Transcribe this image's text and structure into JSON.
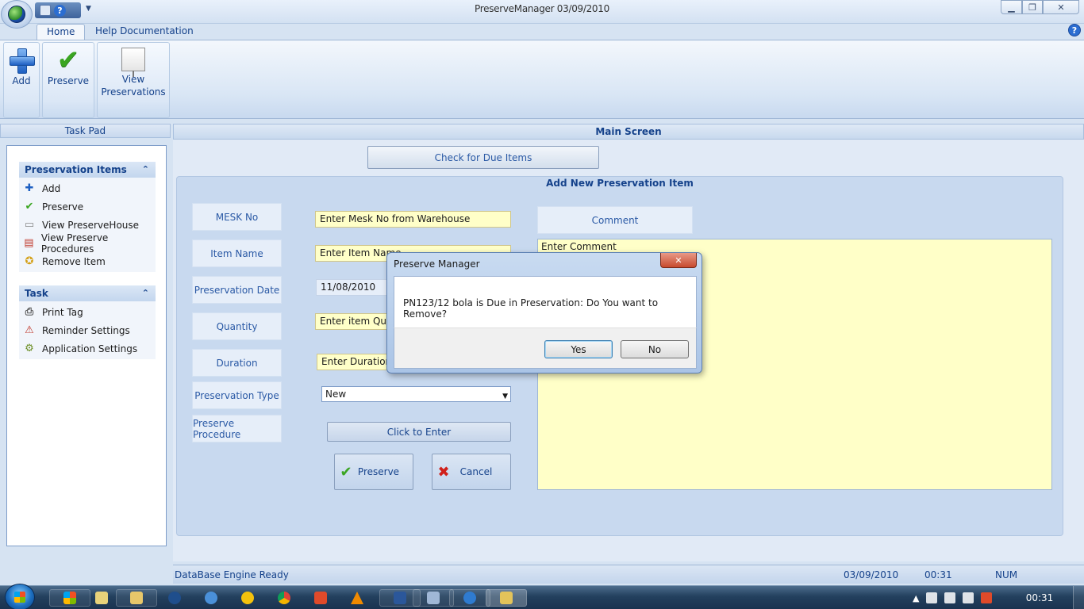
{
  "window": {
    "title": "PreserveManager 03/09/2010"
  },
  "ribbon": {
    "tabs": [
      "Home",
      "Help Documentation"
    ],
    "buttons": [
      {
        "label": "Add",
        "icon": "add-icon"
      },
      {
        "label": "Preserve",
        "icon": "check-icon"
      },
      {
        "label": "View\nPreservations",
        "icon": "board-icon"
      }
    ]
  },
  "taskpad": {
    "title": "Task Pad",
    "sections": [
      {
        "title": "Preservation Items",
        "items": [
          "Add",
          "Preserve",
          "View PreserveHouse",
          "View Preserve Procedures",
          "Remove Item"
        ]
      },
      {
        "title": "Task",
        "items": [
          "Print Tag",
          "Reminder Settings",
          "Application Settings"
        ]
      }
    ]
  },
  "main": {
    "title": "Main Screen",
    "due_button": "Check for Due Items",
    "panel_title": "Add New Preservation Item",
    "labels": {
      "mesk": "MESK No",
      "item_name": "Item Name",
      "date": "Preservation Date",
      "quantity": "Quantity",
      "duration": "Duration",
      "type": "Preservation Type",
      "procedure": "Preserve Procedure",
      "comment": "Comment"
    },
    "inputs": {
      "mesk": "Enter Mesk No from Warehouse",
      "item_name": "Enter Item Name",
      "date": "11/08/2010",
      "quantity": "Enter item Quant",
      "duration": "Enter Duration o",
      "type": "New",
      "comment": "Enter Comment"
    },
    "procedure_button": "Click to Enter",
    "preserve_button": "Preserve",
    "cancel_button": "Cancel"
  },
  "status": {
    "message": "DataBase Engine Ready",
    "date": "03/09/2010",
    "time": "00:31",
    "num": "NUM"
  },
  "dialog": {
    "title": "Preserve Manager",
    "message": "PN123/12 bola is Due in Preservation: Do You want to Remove?",
    "yes": "Yes",
    "no": "No"
  },
  "taskbar": {
    "clock": "00:31"
  }
}
